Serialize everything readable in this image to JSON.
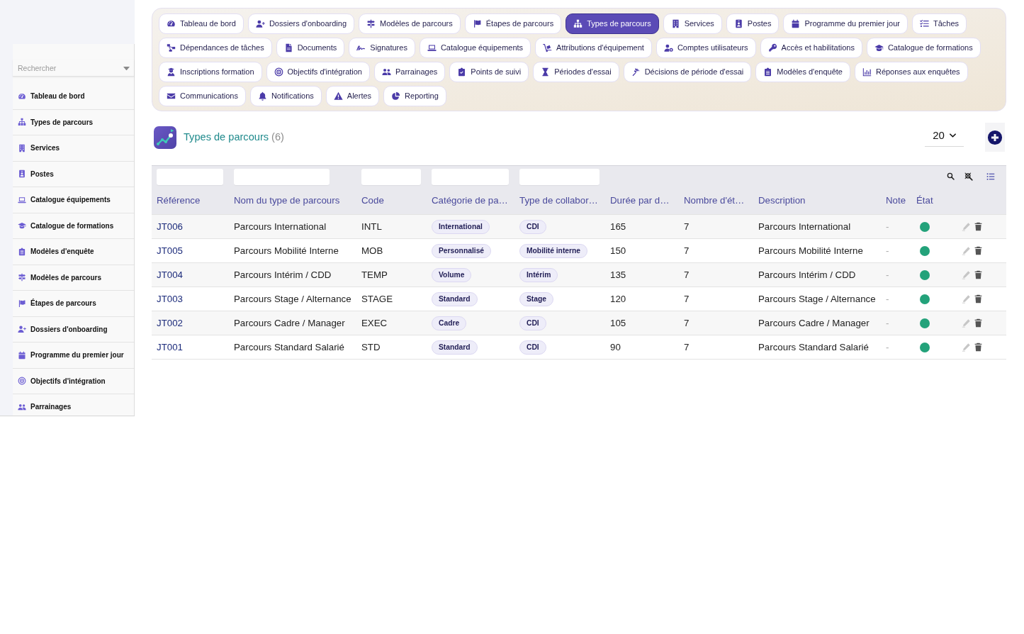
{
  "sidebar": {
    "search": {
      "placeholder": "Rechercher"
    },
    "items": [
      {
        "label": "Tableau de bord",
        "selected": false
      },
      {
        "label": "Types de parcours",
        "selected": false
      },
      {
        "label": "Services",
        "selected": false
      },
      {
        "label": "Postes",
        "selected": false
      },
      {
        "label": "Catalogue équipements",
        "selected": false
      },
      {
        "label": "Catalogue de formations",
        "selected": false
      },
      {
        "label": "Modèles d'enquête",
        "selected": false
      },
      {
        "label": "Modèles de parcours",
        "selected": false
      },
      {
        "label": "Étapes de parcours",
        "selected": false
      },
      {
        "label": "Dossiers d'onboarding",
        "selected": false
      },
      {
        "label": "Programme du premier jour",
        "selected": false
      },
      {
        "label": "Objectifs d'intégration",
        "selected": false
      },
      {
        "label": "Parrainages",
        "selected": false
      }
    ]
  },
  "nav": {
    "items": [
      {
        "label": "Tableau de bord",
        "selected": false
      },
      {
        "label": "Dossiers d'onboarding",
        "selected": false
      },
      {
        "label": "Modèles de parcours",
        "selected": false
      },
      {
        "label": "Étapes de parcours",
        "selected": false
      },
      {
        "label": "Types de parcours",
        "selected": true
      },
      {
        "label": "Services",
        "selected": false
      },
      {
        "label": "Postes",
        "selected": false
      },
      {
        "label": "Programme du premier jour",
        "selected": false
      },
      {
        "label": "Tâches",
        "selected": false
      },
      {
        "label": "Dépendances de tâches",
        "selected": false
      },
      {
        "label": "Documents",
        "selected": false
      },
      {
        "label": "Signatures",
        "selected": false
      },
      {
        "label": "Catalogue équipements",
        "selected": false
      },
      {
        "label": "Attributions d'équipement",
        "selected": false
      },
      {
        "label": "Comptes utilisateurs",
        "selected": false
      },
      {
        "label": "Accès et habilitations",
        "selected": false
      },
      {
        "label": "Catalogue de formations",
        "selected": false
      },
      {
        "label": "Inscriptions formation",
        "selected": false
      },
      {
        "label": "Objectifs d'intégration",
        "selected": false
      },
      {
        "label": "Parrainages",
        "selected": false
      },
      {
        "label": "Points de suivi",
        "selected": false
      },
      {
        "label": "Périodes d'essai",
        "selected": false
      },
      {
        "label": "Décisions de période d'essai",
        "selected": false
      },
      {
        "label": "Modèles d'enquête",
        "selected": false
      },
      {
        "label": "Réponses aux enquêtes",
        "selected": false
      },
      {
        "label": "Communications",
        "selected": false
      },
      {
        "label": "Notifications",
        "selected": false
      },
      {
        "label": "Alertes",
        "selected": false
      },
      {
        "label": "Reporting",
        "selected": false
      }
    ]
  },
  "header": {
    "title": "Types de parcours",
    "count": "(6)",
    "page_size": {
      "value": "20"
    }
  },
  "table": {
    "columns": [
      {
        "label": "Référence",
        "kind": "link",
        "filter": true
      },
      {
        "label": "Nom du type de parcours",
        "kind": "text",
        "filter": true
      },
      {
        "label": "Code",
        "kind": "text",
        "filter": true
      },
      {
        "label": "Catégorie de pa…",
        "kind": "tag",
        "filter": true
      },
      {
        "label": "Type de collabor…",
        "kind": "tag",
        "filter": true
      },
      {
        "label": "Durée par d…",
        "kind": "text",
        "filter": false
      },
      {
        "label": "Nombre d'ét…",
        "kind": "text",
        "filter": false
      },
      {
        "label": "Description",
        "kind": "text",
        "filter": false
      },
      {
        "label": "Note",
        "kind": "muted",
        "filter": false
      },
      {
        "label": "État",
        "kind": "status",
        "filter": false
      }
    ],
    "rows": [
      {
        "cells": [
          "JT006",
          "Parcours International",
          "INTL",
          "International",
          "CDI",
          "165",
          "7",
          "Parcours International",
          "-"
        ],
        "active": true
      },
      {
        "cells": [
          "JT005",
          "Parcours Mobilité Interne",
          "MOB",
          "Personnalisé",
          "Mobilité interne",
          "150",
          "7",
          "Parcours Mobilité Interne",
          "-"
        ],
        "active": true
      },
      {
        "cells": [
          "JT004",
          "Parcours Intérim / CDD",
          "TEMP",
          "Volume",
          "Intérim",
          "135",
          "7",
          "Parcours Intérim / CDD",
          "-"
        ],
        "active": true
      },
      {
        "cells": [
          "JT003",
          "Parcours Stage / Alternance",
          "STAGE",
          "Standard",
          "Stage",
          "120",
          "7",
          "Parcours Stage / Alternance",
          "-"
        ],
        "active": true
      },
      {
        "cells": [
          "JT002",
          "Parcours Cadre / Manager",
          "EXEC",
          "Cadre",
          "CDI",
          "105",
          "7",
          "Parcours Cadre / Manager",
          "-"
        ],
        "active": true
      },
      {
        "cells": [
          "JT001",
          "Parcours Standard Salarié",
          "STD",
          "Standard",
          "CDI",
          "90",
          "7",
          "Parcours Standard Salarié",
          "-"
        ],
        "active": true
      }
    ]
  }
}
